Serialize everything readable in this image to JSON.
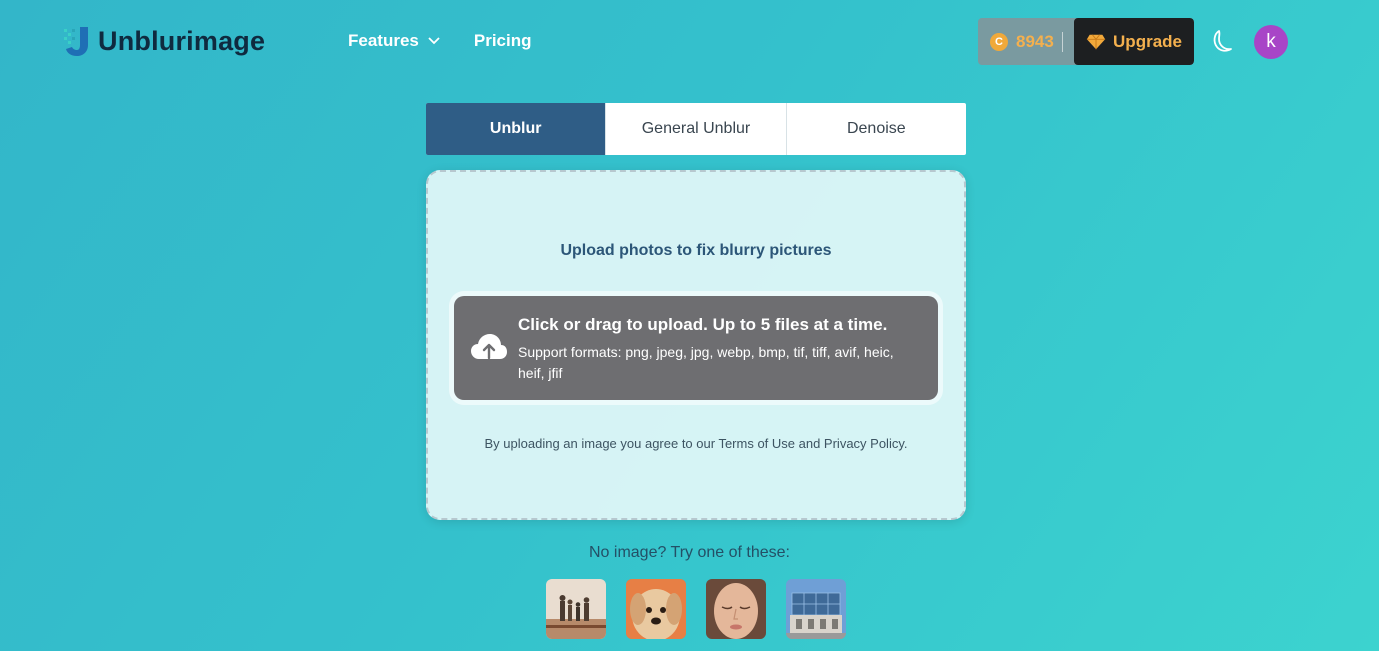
{
  "brand": {
    "name": "Unblurimage"
  },
  "nav": {
    "features": "Features",
    "pricing": "Pricing"
  },
  "account": {
    "credits": "8943",
    "upgrade_label": "Upgrade",
    "avatar_initial": "k"
  },
  "tabs": [
    {
      "label": "Unblur",
      "active": true
    },
    {
      "label": "General Unblur",
      "active": false
    },
    {
      "label": "Denoise",
      "active": false
    }
  ],
  "upload": {
    "title": "Upload photos to fix blurry pictures",
    "main": "Click or drag to upload. Up to 5 files at a time.",
    "formats": "Support formats: png, jpeg, jpg, webp, bmp, tif, tiff, avif, heic, heif, jfif",
    "terms": "By uploading an image you agree to our Terms of Use and Privacy Policy."
  },
  "samples": {
    "label": "No image? Try one of these:",
    "items": [
      "family-photo",
      "puppy-photo",
      "face-photo",
      "building-photo"
    ]
  },
  "colors": {
    "active_tab": "#2f5d86",
    "accent_gold": "#f4b04e",
    "avatar": "#a845c7",
    "dropzone": "#6e6e71"
  }
}
